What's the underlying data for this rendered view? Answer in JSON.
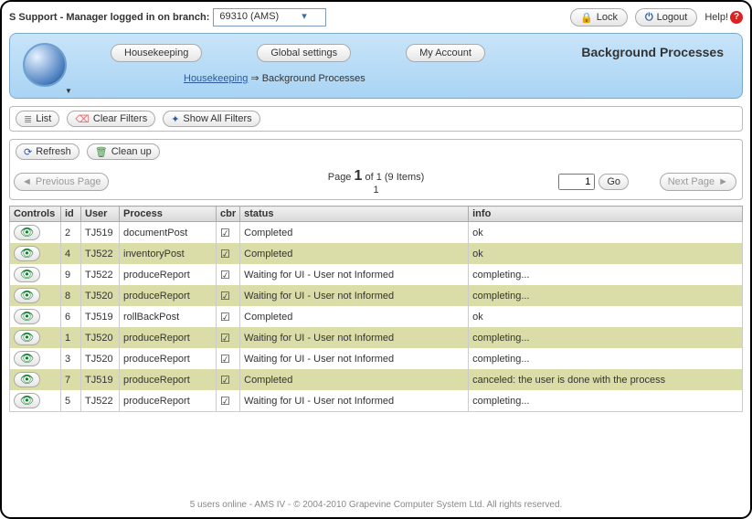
{
  "top": {
    "title_prefix": "S Support - Manager logged in on branch:",
    "branch_options": "69310 (AMS)",
    "lock": "Lock",
    "logout": "Logout",
    "help": "Help!"
  },
  "header": {
    "tabs": {
      "housekeeping": "Housekeeping",
      "global_settings": "Global settings",
      "my_account": "My Account"
    },
    "page_title": "Background Processes",
    "breadcrumb": {
      "a": "Housekeeping",
      "sep": "⇒",
      "b": "Background Processes"
    }
  },
  "filters": {
    "list": "List",
    "clear": "Clear Filters",
    "show_all": "Show All Filters"
  },
  "actions": {
    "refresh": "Refresh",
    "cleanup": "Clean up"
  },
  "pager": {
    "prev": "Previous Page",
    "next": "Next Page",
    "label_a": "Page",
    "current": "1",
    "label_b": "of 1 (9 Items)",
    "sub": "1",
    "goto_value": "1",
    "go": "Go"
  },
  "columns": {
    "controls": "Controls",
    "id": "id",
    "user": "User",
    "process": "Process",
    "cbr": "cbr",
    "status": "status",
    "info": "info"
  },
  "rows": [
    {
      "id": "2",
      "user": "TJ519",
      "process": "documentPost",
      "status": "Completed",
      "info": "ok"
    },
    {
      "id": "4",
      "user": "TJ522",
      "process": "inventoryPost",
      "status": "Completed",
      "info": "ok"
    },
    {
      "id": "9",
      "user": "TJ522",
      "process": "produceReport",
      "status": "Waiting for UI - User not Informed",
      "info": "completing..."
    },
    {
      "id": "8",
      "user": "TJ520",
      "process": "produceReport",
      "status": "Waiting for UI - User not Informed",
      "info": "completing..."
    },
    {
      "id": "6",
      "user": "TJ519",
      "process": "rollBackPost",
      "status": "Completed",
      "info": "ok"
    },
    {
      "id": "1",
      "user": "TJ520",
      "process": "produceReport",
      "status": "Waiting for UI - User not Informed",
      "info": "completing..."
    },
    {
      "id": "3",
      "user": "TJ520",
      "process": "produceReport",
      "status": "Waiting for UI - User not Informed",
      "info": "completing..."
    },
    {
      "id": "7",
      "user": "TJ519",
      "process": "produceReport",
      "status": "Completed",
      "info": "canceled: the user is done with the process"
    },
    {
      "id": "5",
      "user": "TJ522",
      "process": "produceReport",
      "status": "Waiting for UI - User not Informed",
      "info": "completing..."
    }
  ],
  "footer": "5 users online - AMS IV - © 2004-2010 Grapevine Computer System Ltd. All rights reserved."
}
